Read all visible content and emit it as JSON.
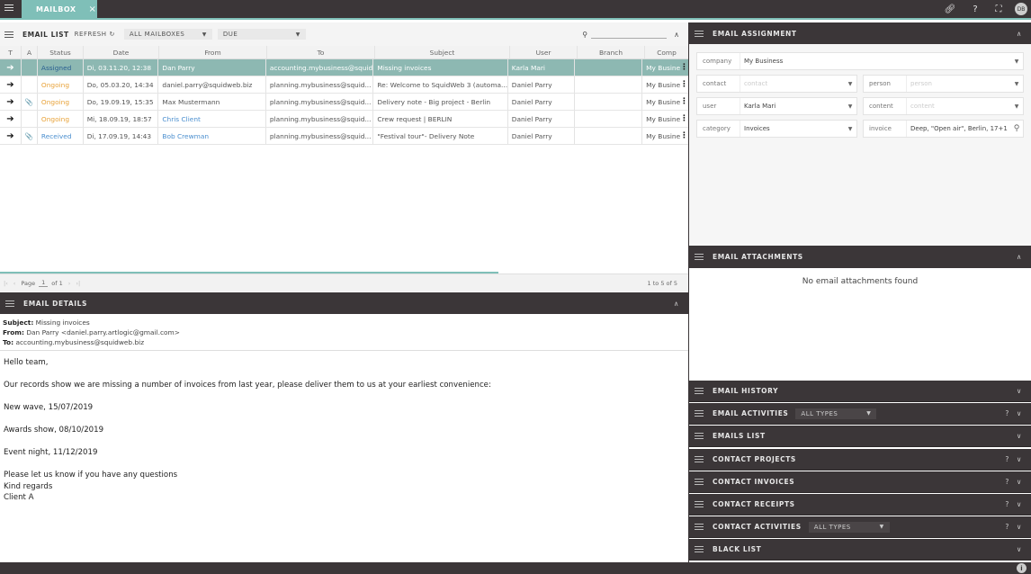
{
  "app": {
    "tab_label": "MAILBOX",
    "tab_close": "×",
    "user_initials": "DB"
  },
  "email_list": {
    "title": "EMAIL LIST",
    "refresh_label": "REFRESH",
    "mailbox_filter": "ALL MAILBOXES",
    "due_filter": "DUE",
    "columns": [
      "T",
      "A",
      "Status",
      "Date",
      "From",
      "To",
      "Subject",
      "User",
      "Branch",
      "Comp"
    ],
    "rows": [
      {
        "attach": "",
        "status": "Assigned",
        "status_class": "assigned",
        "date": "Di, 03.11.20, 12:38",
        "from": "Dan Parry",
        "from_link": false,
        "to": "accounting.mybusiness@squid...",
        "subject": "Missing invoices",
        "user": "Karla Mari",
        "branch": "",
        "comp": "My Busine"
      },
      {
        "attach": "",
        "status": "Ongoing",
        "status_class": "ongoing",
        "date": "Do, 05.03.20, 14:34",
        "from": "daniel.parry@squidweb.biz",
        "from_link": false,
        "to": "planning.mybusiness@squid...",
        "subject": "Re: Welcome to SquidWeb 3 (automa...",
        "user": "Daniel Parry",
        "branch": "",
        "comp": "My Busine"
      },
      {
        "attach": "📎",
        "status": "Ongoing",
        "status_class": "ongoing",
        "date": "Do, 19.09.19, 15:35",
        "from": "Max Mustermann",
        "from_link": false,
        "to": "planning.mybusiness@squid...",
        "subject": "Delivery note - Big project - Berlin",
        "user": "Daniel Parry",
        "branch": "",
        "comp": "My Busine"
      },
      {
        "attach": "",
        "status": "Ongoing",
        "status_class": "ongoing",
        "date": "Mi, 18.09.19, 18:57",
        "from": "Chris Client",
        "from_link": true,
        "to": "planning.mybusiness@squid...",
        "subject": "Crew request | BERLIN",
        "user": "Daniel Parry",
        "branch": "",
        "comp": "My Busine"
      },
      {
        "attach": "📎",
        "status": "Received",
        "status_class": "received",
        "date": "Di, 17.09.19, 14:43",
        "from": "Bob Crewman",
        "from_link": true,
        "to": "planning.mybusiness@squid...",
        "subject": "\"Festival tour\"- Delivery Note",
        "user": "Daniel Parry",
        "branch": "",
        "comp": "My Busine"
      }
    ],
    "pager": {
      "page_label": "Page",
      "page": "1",
      "of_label": "of 1",
      "count": "1 to 5 of 5"
    }
  },
  "email_details": {
    "title": "EMAIL DETAILS",
    "subject_label": "Subject:",
    "subject": "Missing invoices",
    "from_label": "From:",
    "from": "Dan Parry <daniel.parry.artlogic@gmail.com>",
    "to_label": "To:",
    "to": "accounting.mybusiness@squidweb.biz",
    "body": [
      "Hello team,",
      "",
      "Our records show we are missing a number of invoices from last year, please deliver them to us at your earliest convenience:",
      "",
      "New wave, 15/07/2019",
      "",
      "Awards show, 08/10/2019",
      "",
      "Event night, 11/12/2019",
      "",
      "Please let us know if you have any questions",
      "Kind regards",
      "Client A"
    ]
  },
  "assignment": {
    "title": "EMAIL ASSIGNMENT",
    "company_label": "company",
    "company": "My Business",
    "contact_label": "contact",
    "contact_ph": "contact",
    "person_label": "person",
    "person_ph": "person",
    "user_label": "user",
    "user": "Karla Mari",
    "content_label": "content",
    "content_ph": "content",
    "category_label": "category",
    "category": "Invoices",
    "invoice_label": "invoice",
    "invoice": "Deep, \"Open air\", Berlin, 17+1"
  },
  "attachments": {
    "title": "EMAIL ATTACHMENTS",
    "empty": "No email attachments found"
  },
  "sections": [
    {
      "title": "EMAIL HISTORY",
      "help": false,
      "filter": ""
    },
    {
      "title": "EMAIL ACTIVITIES",
      "help": true,
      "filter": "ALL TYPES"
    },
    {
      "title": "EMAILS LIST",
      "help": false,
      "filter": ""
    },
    {
      "title": "CONTACT PROJECTS",
      "help": true,
      "filter": ""
    },
    {
      "title": "CONTACT INVOICES",
      "help": true,
      "filter": ""
    },
    {
      "title": "CONTACT RECEIPTS",
      "help": true,
      "filter": ""
    },
    {
      "title": "CONTACT ACTIVITIES",
      "help": true,
      "filter": "ALL TYPES"
    },
    {
      "title": "BLACK LIST",
      "help": false,
      "filter": ""
    }
  ],
  "colors": {
    "accent": "#7fbfb8",
    "dark": "#3b3638",
    "selected_row": "#8db8b2"
  }
}
